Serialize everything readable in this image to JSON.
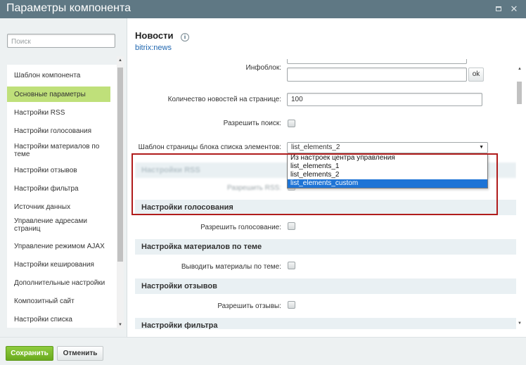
{
  "window": {
    "title": "Параметры компонента",
    "maximize_icon": "maximize-icon",
    "close_icon": "close-icon",
    "close_glyph": "✕"
  },
  "sidebar": {
    "search_placeholder": "Поиск",
    "items": [
      {
        "label": "Шаблон компонента",
        "active": false
      },
      {
        "label": "Основные параметры",
        "active": true
      },
      {
        "label": "Настройки RSS",
        "active": false
      },
      {
        "label": "Настройки голосования",
        "active": false
      },
      {
        "label": "Настройки материалов по теме",
        "active": false
      },
      {
        "label": "Настройки отзывов",
        "active": false
      },
      {
        "label": "Настройки фильтра",
        "active": false
      },
      {
        "label": "Источник данных",
        "active": false
      },
      {
        "label": "Управление адресами страниц",
        "active": false
      },
      {
        "label": "Управление режимом AJAX",
        "active": false
      },
      {
        "label": "Настройки кеширования",
        "active": false
      },
      {
        "label": "Дополнительные настройки",
        "active": false
      },
      {
        "label": "Композитный сайт",
        "active": false
      },
      {
        "label": "Настройки списка",
        "active": false
      }
    ]
  },
  "component": {
    "title": "Новости",
    "info_glyph": "i",
    "code": "bitrix:news"
  },
  "form": {
    "infoblock_label": "Инфоблок:",
    "infoblock_value": "",
    "ok_label": "ok",
    "news_count_label": "Количество новостей на странице:",
    "news_count_value": "100",
    "allow_search_label": "Разрешить поиск:",
    "list_template_label": "Шаблон страницы блока списка элементов:",
    "list_template_value": "list_elements_2",
    "caret_glyph": "▼",
    "dropdown_options": [
      {
        "label": "Из настроек центра управления",
        "selected": false
      },
      {
        "label": "list_elements_1",
        "selected": false
      },
      {
        "label": "list_elements_2",
        "selected": false
      },
      {
        "label": "list_elements_custom",
        "selected": true
      }
    ],
    "rss_section": "Настройки RSS",
    "rss_label": "Разрешить RSS:",
    "voting_section": "Настройки голосования",
    "voting_label": "Разрешить голосование:",
    "related_section": "Настройка материалов по теме",
    "related_label": "Выводить материалы по теме:",
    "reviews_section": "Настройки отзывов",
    "reviews_label": "Разрешить отзывы:",
    "filter_section": "Настройки фильтра"
  },
  "footer": {
    "save_label": "Сохранить",
    "cancel_label": "Отменить"
  },
  "colors": {
    "titlebar": "#5f7884",
    "active_item": "#bfe07a",
    "save_button": "#7bbb2a",
    "highlight_border": "#b01c1c",
    "dropdown_selected": "#1e74d6",
    "link": "#2067b0"
  }
}
